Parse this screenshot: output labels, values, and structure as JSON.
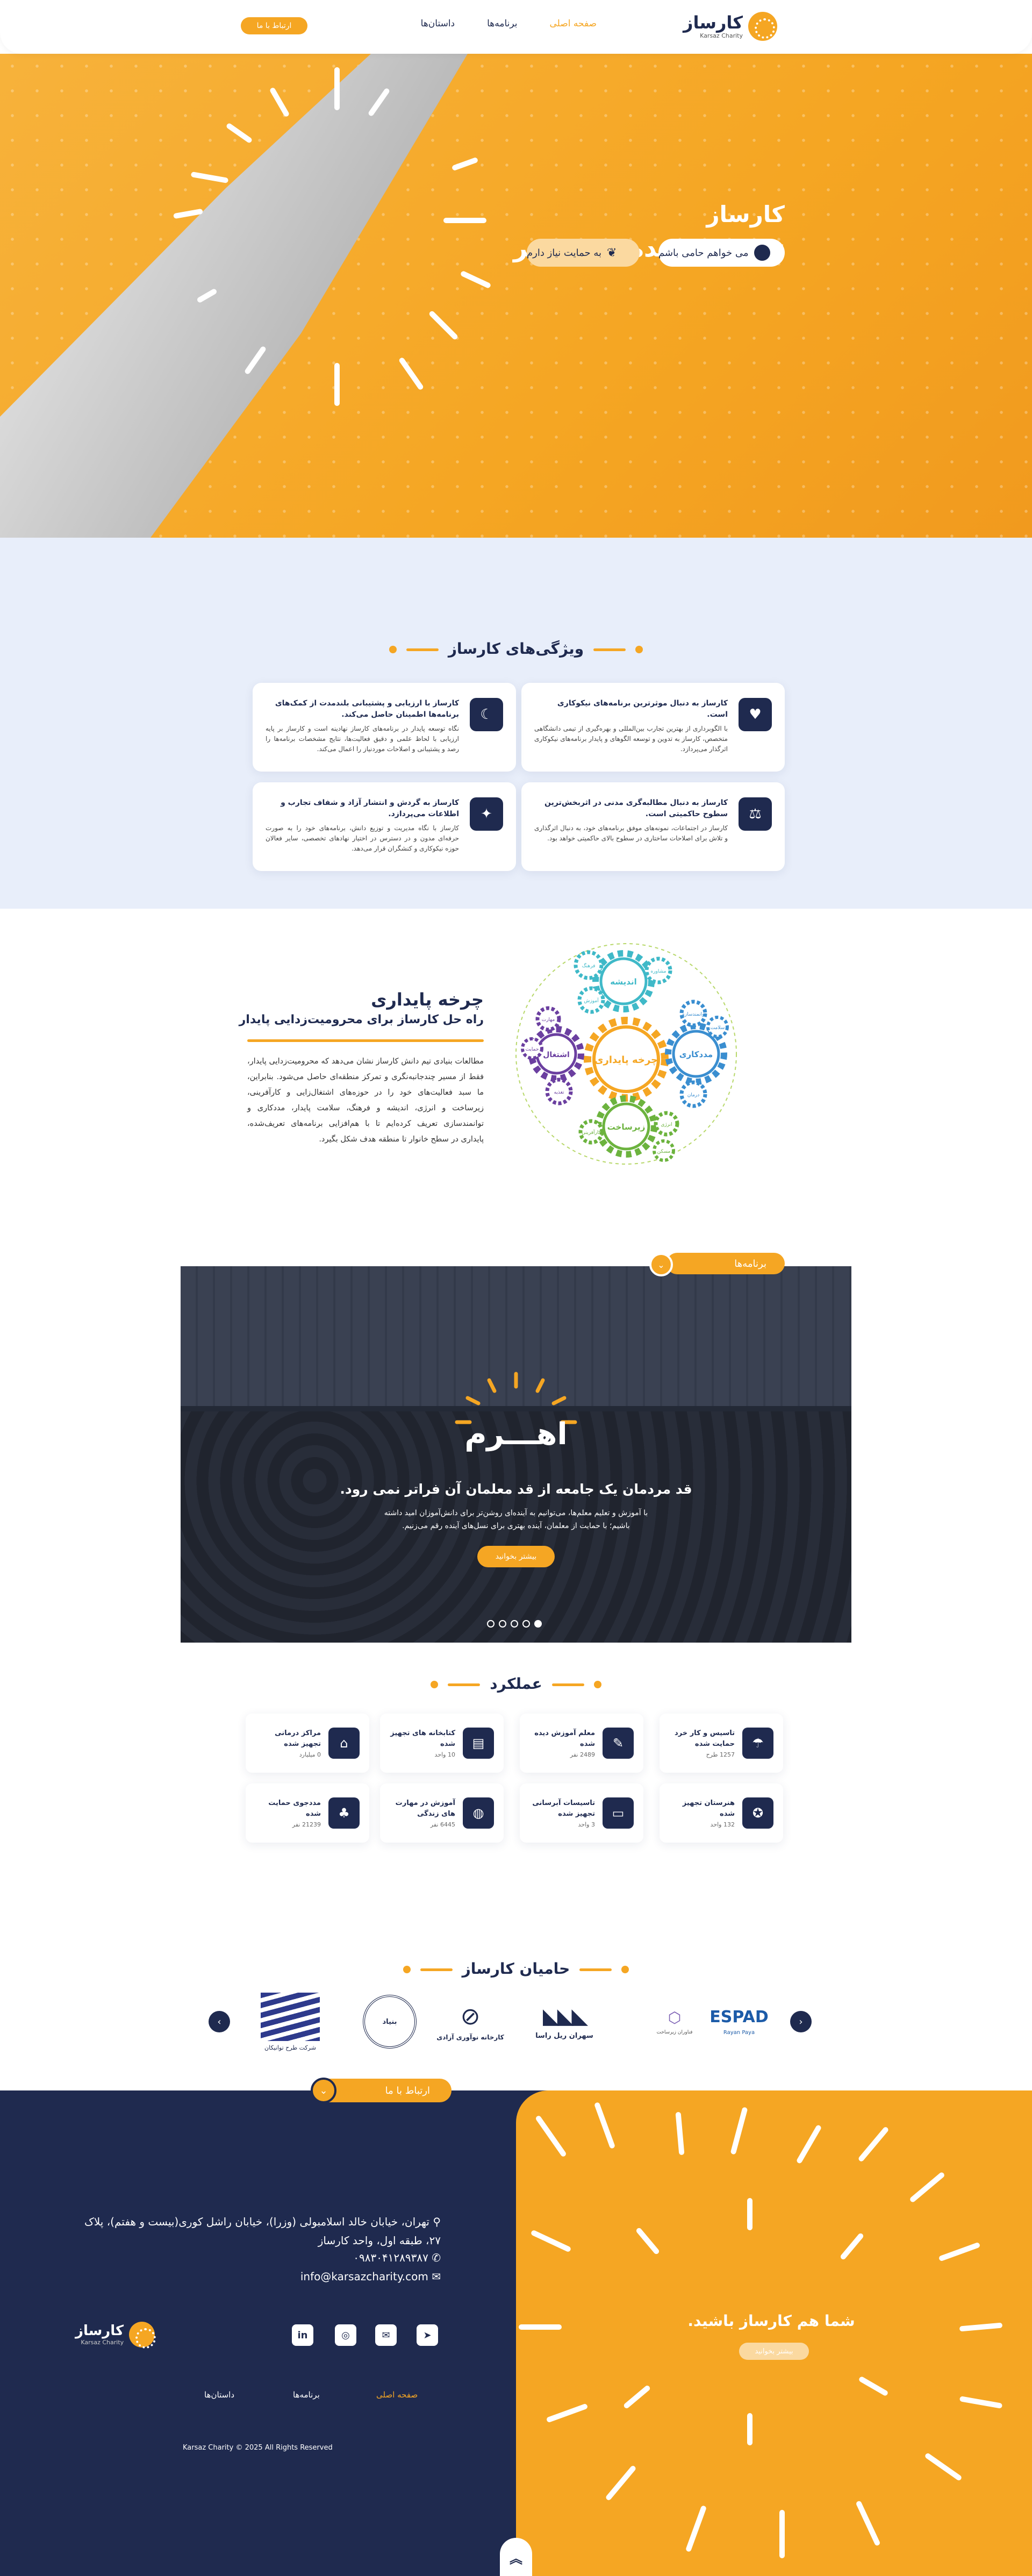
{
  "header": {
    "logo_name": "کارساز",
    "logo_sub": "Karsaz Charity",
    "nav": [
      "صفحه اصلی",
      "برنامه‌ها",
      "داستان‌ها"
    ],
    "contact_btn": "ارتباط با ما"
  },
  "hero": {
    "title": "کارساز",
    "subtitle": "توسعه دهنده خیر موثر",
    "btn_primary": "می خواهم حامی باشم",
    "btn_secondary": "به حمایت نیاز دارم"
  },
  "features": {
    "title": "ویژگی‌های کارساز",
    "items": [
      {
        "icon": "heart-hand-icon",
        "title": "کارساز به دنبال موثرترین برنامه‌های نیکوکاری است.",
        "text": "با الگوبرداری از بهترین تجارب بین‌المللی و بهره‌گیری از تیمی دانشگاهی متخصص، کارساز به تدوین و توسعه الگوهای و پایدار برنامه‌های نیکوکاری اثرگذار می‌پردازد."
      },
      {
        "icon": "star-moon-icon",
        "title": "کارساز با ارزیابی و پشتیبانی بلندمدت از کمک‌های برنامه‌ها اطمینان حاصل می‌کند.",
        "text": "نگاه توسعه پایدار در برنامه‌های کارساز نهادینه است و کارساز بر پایه ارزیابی با لحاظ علمی و دقیق فعالیت‌ها، نتایج مشخصات برنامه‌ها را رصد و پشتیبانی و اصلاحات موردنیاز را اعمال می‌کند."
      },
      {
        "icon": "gavel-icon",
        "title": "کارساز به دنبال مطالبه‌گری مدنی در اثربخش‌ترین سطوح حاکمیتی است.",
        "text": "کارساز در اجتماعات، نمونه‌های موفق برنامه‌های خود، به دنبال اثرگذاری و تلاش برای اصلاحات ساختاری در سطوح بالای حاکمیتی خواهد بود."
      },
      {
        "icon": "bulb-icon",
        "title": "کارساز به گردش و انتشار آزاد و شفاف تجارب و اطلاعات می‌پردازد.",
        "text": "کارساز با نگاه مدیریت و توزیع دانش، برنامه‌های خود را به صورت حرفه‌ای مدون و در دسترس در اختیار نهادهای تخصصی، سایر فعالان حوزه نیکوکاری و کنشگران قرار می‌دهد."
      }
    ]
  },
  "cycle": {
    "title": "چرخه پایداری",
    "subtitle": "راه حل کارساز برای محرومیت‌زدایی پایدار",
    "text": "مطالعات بنیادی تیم دانش کارساز نشان می‌دهد که محرومیت‌زدایی پایدار، فقط از مسیر چندجانبه‌نگری و تمرکز منطقه‌ای حاصل می‌شود. بنابراین، ما سبد فعالیت‌های خود را در حوزه‌های اشتغال‌زایی و کارآفرینی، زیرساخت و انرژی، اندیشه و فرهنگ، سلامت پایدار، مددکاری و توانمندسازی تعریف کرده‌ایم تا با هم‌افزایی برنامه‌های تعریف‌شده، پایداری در سطح خانوار تا منطقه هدف شکل بگیرد.",
    "hub": "چرخه پایداری",
    "gears": [
      "اندیشه",
      "مددکاری",
      "زیرساخت",
      "اشتغال"
    ],
    "small_gears": [
      "فرهنگ",
      "آموزش",
      "مشاوره",
      "توانمندسازی",
      "سلامت",
      "درمان",
      "انرژی",
      "مسکن",
      "کارآفرینی",
      "مهارت",
      "حمایت",
      "تغذیه"
    ]
  },
  "programs": {
    "tag": "برنامه‌ها",
    "slide_brand": "اهـــرم",
    "slide_tagline": "قد مردمان یک جامعه از قد معلمان آن فراتر نمی رود.",
    "slide_desc": "با آموزش و تعلیم معلم‌ها، می‌توانیم به آینده‌ای روشن‌تر برای دانش‌آموزان امید داشته باشیم؛ با حمایت از معلمان، آینده بهتری برای نسل‌های آینده رقم می‌زنیم.",
    "slide_btn": "بیشتر بخوانید"
  },
  "performance": {
    "title": "عملکرد",
    "stats": [
      {
        "icon": "umbrella-icon",
        "title": "تاسیس و کار خرد حمایت شده",
        "value": "1257 طرح"
      },
      {
        "icon": "teacher-icon",
        "title": "معلم آموزش دیده شده",
        "value": "2489 نفر"
      },
      {
        "icon": "books-icon",
        "title": "کتابخانه های تجهیز شده",
        "value": "10 واحد"
      },
      {
        "icon": "house-icon",
        "title": "مراکز درمانی تجهیز شده",
        "value": "0 میلیارد"
      },
      {
        "icon": "school-icon",
        "title": "هنرستان تجهیز شده",
        "value": "132 واحد"
      },
      {
        "icon": "card-icon",
        "title": "تاسیسات آبرسانی تجهیز شده",
        "value": "3 واحد"
      },
      {
        "icon": "globe-icon",
        "title": "آموزش در مهارت های زندگی",
        "value": "6445 نفر"
      },
      {
        "icon": "tree-icon",
        "title": "مددجوی حمایت شده",
        "value": "21239 نفر"
      }
    ]
  },
  "sponsors": {
    "title": "حامیان کارساز",
    "items": [
      {
        "name": "ESPAD",
        "sub": "Rayan Paya"
      },
      {
        "name": "فناوران زیرساخت",
        "sub": ""
      },
      {
        "name": "سهران ریل راسا",
        "sub": ""
      },
      {
        "name": "کارخانه نوآوری آزادی",
        "sub": ""
      },
      {
        "name": "بنیاد",
        "sub": ""
      },
      {
        "name": "شرکت طرح توانیکان",
        "sub": ""
      }
    ]
  },
  "footer": {
    "contact_tag": "ارتباط با ما",
    "address": "تهران، خیابان خالد اسلامبولی (وزرا)، خیابان راشل کوری(بیست و هفتم)، پلاک ۲۷، طبقه اول، واحد کارساز",
    "phone": "۰۹۸۳۰۴۱۲۸۹۳۸۷",
    "email": "info@karsazcharity.com",
    "nav": [
      "صفحه اصلی",
      "برنامه‌ها",
      "داستان‌ها"
    ],
    "copyright": "Karsaz Charity © 2025 All Rights Reserved",
    "cta_title": "شما هم کارساز باشید.",
    "cta_btn": "بیشتر بخوانید",
    "logo_name": "کارساز",
    "logo_sub": "Karsaz Charity"
  },
  "colors": {
    "accent": "#f5a623",
    "navy": "#1f2a4f",
    "bg_light": "#e8eefa"
  }
}
